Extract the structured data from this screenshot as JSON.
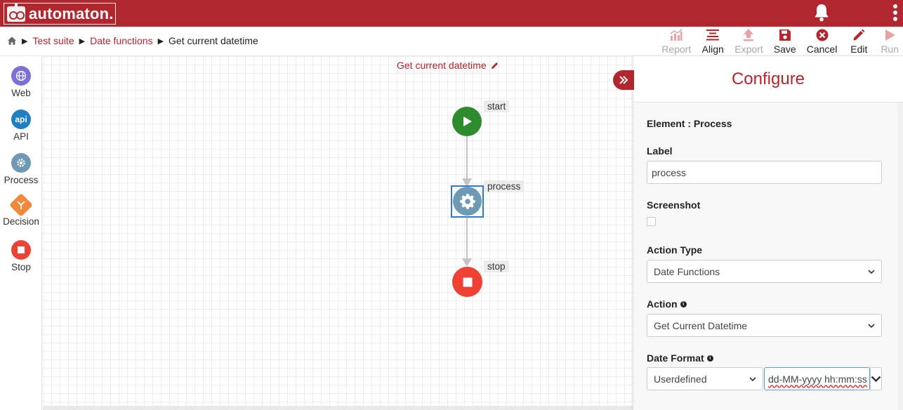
{
  "app": {
    "logo_text": "automaton.",
    "accent_color": "#b2262e"
  },
  "breadcrumb": {
    "items": [
      "Test suite",
      "Date functions"
    ],
    "current": "Get current datetime"
  },
  "toolbar": {
    "report": "Report",
    "align": "Align",
    "export": "Export",
    "save": "Save",
    "cancel": "Cancel",
    "edit": "Edit",
    "run": "Run"
  },
  "palette": {
    "items": [
      {
        "label": "Web",
        "icon": "globe-icon",
        "color": "#7b70d6"
      },
      {
        "label": "API",
        "icon": "api-icon",
        "icon_text": "api",
        "color": "#1f7fc1"
      },
      {
        "label": "Process",
        "icon": "gear-icon",
        "color": "#6f9ab3"
      },
      {
        "label": "Decision",
        "icon": "decision-icon",
        "color": "#f08a3a"
      },
      {
        "label": "Stop",
        "icon": "stop-icon",
        "color": "#ee4235"
      }
    ]
  },
  "flow": {
    "title": "Get current datetime",
    "nodes": {
      "start": "start",
      "process": "process",
      "stop": "stop"
    }
  },
  "panel": {
    "title": "Configure",
    "element_label": "Element : Process",
    "label_field": {
      "label": "Label",
      "value": "process"
    },
    "screenshot": {
      "label": "Screenshot",
      "checked": false
    },
    "action_type": {
      "label": "Action Type",
      "value": "Date Functions"
    },
    "action": {
      "label": "Action",
      "value": "Get Current Datetime"
    },
    "date_format": {
      "label": "Date Format",
      "type_value": "Userdefined",
      "format_value": "dd-MM-yyyy hh:mm:ss"
    }
  }
}
